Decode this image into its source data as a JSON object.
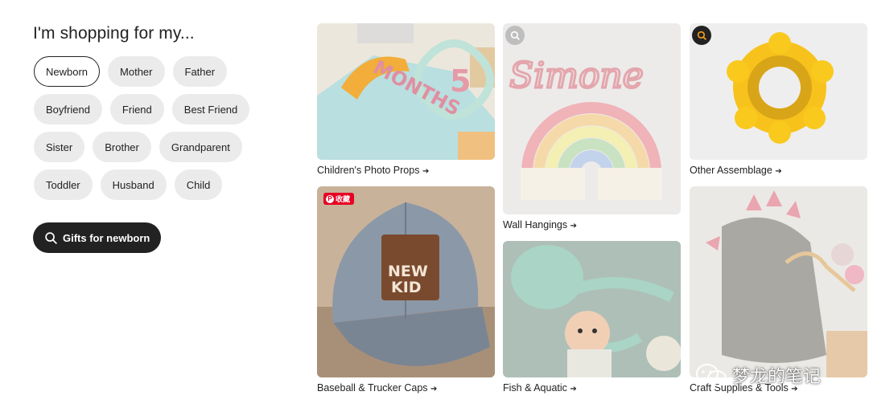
{
  "heading": "I'm shopping for my...",
  "chips": [
    [
      {
        "label": "Newborn",
        "selected": true
      },
      {
        "label": "Mother"
      },
      {
        "label": "Father"
      }
    ],
    [
      {
        "label": "Boyfriend"
      },
      {
        "label": "Friend"
      },
      {
        "label": "Best Friend"
      }
    ],
    [
      {
        "label": "Sister"
      },
      {
        "label": "Brother"
      },
      {
        "label": "Grandparent"
      }
    ],
    [
      {
        "label": "Toddler"
      },
      {
        "label": "Husband"
      },
      {
        "label": "Child"
      }
    ]
  ],
  "cta": {
    "label": "Gifts for newborn",
    "icon": "search-icon"
  },
  "cards": {
    "photo_props": {
      "caption": "Children's Photo Props",
      "arrow": "➔"
    },
    "caps": {
      "caption": "Baseball & Trucker Caps",
      "arrow": "➔",
      "badge": "收藏",
      "hat_text_1": "NEW",
      "hat_text_2": "KID"
    },
    "wall": {
      "caption": "Wall Hangings",
      "arrow": "➔",
      "yarn_text": "Simone"
    },
    "fish": {
      "caption": "Fish & Aquatic",
      "arrow": "➔"
    },
    "assemblage": {
      "caption": "Other Assemblage",
      "arrow": "➔"
    },
    "craft": {
      "caption": "Craft Supplies & Tools",
      "arrow": "➔"
    },
    "photo_props_text": {
      "num": "5",
      "word": "MONTHS"
    }
  },
  "watermark": "梦龙的笔记",
  "colors": {
    "accent": "#222222",
    "chip_bg": "#ebebeb",
    "pin_red": "#e60023"
  }
}
